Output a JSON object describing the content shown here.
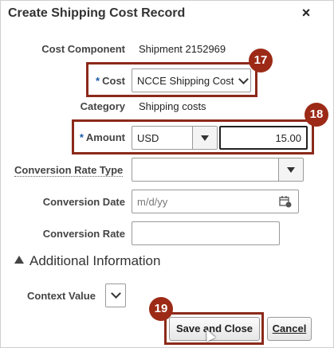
{
  "dialog": {
    "title": "Create Shipping Cost Record",
    "close_icon": "×"
  },
  "form": {
    "cost_component": {
      "label": "Cost Component",
      "value": "Shipment 2152969"
    },
    "cost": {
      "required_marker": "*",
      "label": "Cost",
      "value": "NCCE Shipping Cost"
    },
    "category": {
      "label": "Category",
      "value": "Shipping costs"
    },
    "amount": {
      "required_marker": "*",
      "label": "Amount",
      "currency": "USD",
      "value": "15.00"
    },
    "conversion_rate_type": {
      "label": "Conversion Rate Type",
      "value": ""
    },
    "conversion_date": {
      "label": "Conversion Date",
      "placeholder": "m/d/yy"
    },
    "conversion_rate": {
      "label": "Conversion Rate",
      "value": ""
    }
  },
  "additional_information": {
    "heading": "Additional Information",
    "context_value": {
      "label": "Context Value"
    }
  },
  "buttons": {
    "save_and_close": "Save and Close",
    "cancel": "Cancel"
  },
  "callouts": {
    "cost": "17",
    "amount": "18",
    "save": "19"
  },
  "colors": {
    "callout": "#9c2a16",
    "required": "#1a5aa8"
  }
}
